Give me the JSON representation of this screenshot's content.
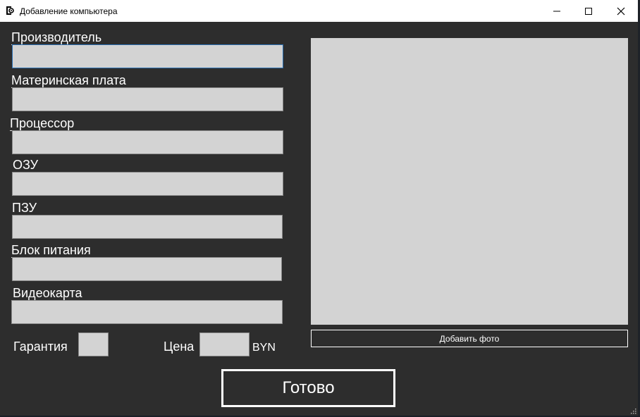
{
  "window": {
    "title": "Добавление компьютера",
    "controls": {
      "minimize": "—",
      "maximize": "☐",
      "close": "✕"
    }
  },
  "form": {
    "fields": [
      {
        "label": "Производитель",
        "value": ""
      },
      {
        "label": "Материнская плата",
        "value": ""
      },
      {
        "label": "Процессор",
        "value": ""
      },
      {
        "label": "ОЗУ",
        "value": ""
      },
      {
        "label": "ПЗУ",
        "value": ""
      },
      {
        "label": "Блок питания",
        "value": ""
      },
      {
        "label": "Видеокарта",
        "value": ""
      }
    ],
    "warranty": {
      "label": "Гарантия",
      "value": ""
    },
    "price": {
      "label": "Цена",
      "value": "",
      "currency": "BYN"
    }
  },
  "photo": {
    "add_button": "Добавить фото"
  },
  "done_button": "Готово",
  "colors": {
    "background": "#2d2d2d",
    "field": "#d3d3d3",
    "text": "#ffffff",
    "focus_border": "#2a6fb3"
  }
}
